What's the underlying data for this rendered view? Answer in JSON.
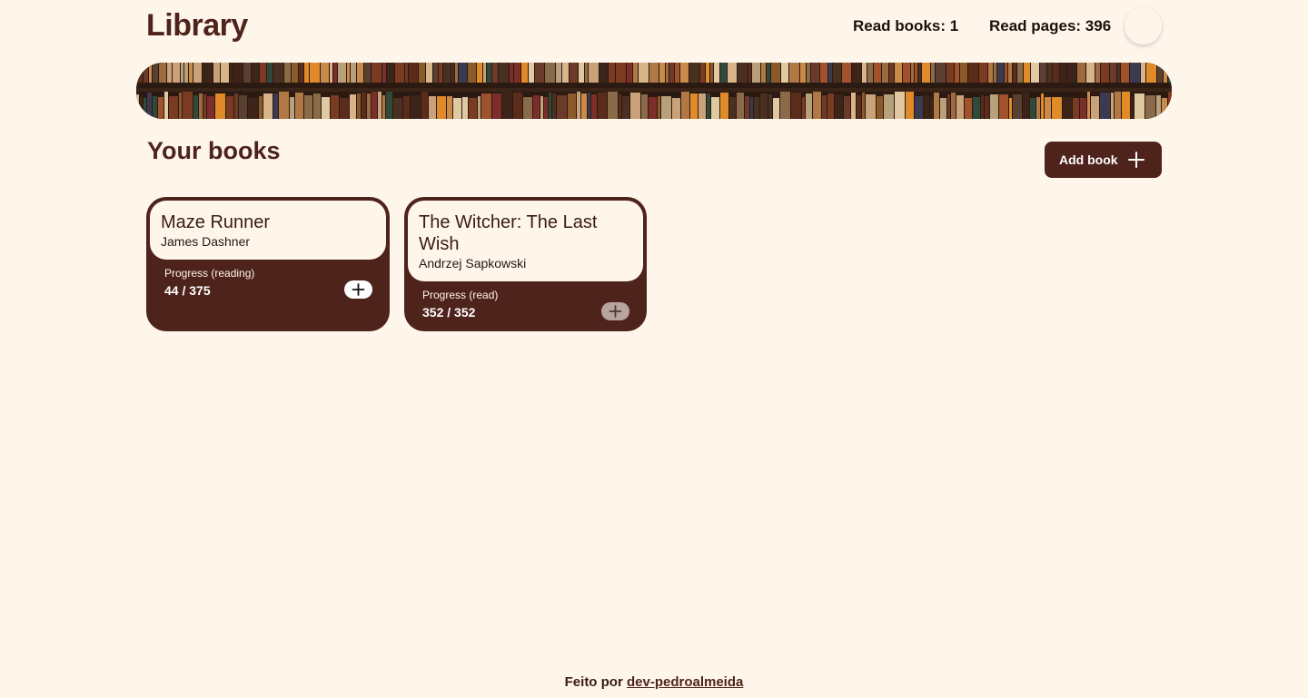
{
  "header": {
    "title": "Library",
    "read_books": "Read books: 1",
    "read_pages": "Read pages: 396"
  },
  "section": {
    "title": "Your books",
    "add_button_label": "Add book",
    "add_button_icon": "plus-icon"
  },
  "books": [
    {
      "title": "Maze Runner",
      "author": "James Dashner",
      "progress_label": "Progress (reading)",
      "progress_value": "44 / 375",
      "pages_read": 44,
      "pages_total": 375,
      "add_pages_enabled": true
    },
    {
      "title": "The Witcher: The Last Wish",
      "author": "Andrzej Sapkowski",
      "progress_label": "Progress (read)",
      "progress_value": "352 / 352",
      "pages_read": 352,
      "pages_total": 352,
      "add_pages_enabled": false
    }
  ],
  "footer": {
    "prefix": "Feito por",
    "link_text": "dev-pedroalmeida"
  },
  "colors": {
    "background": "#fff6eb",
    "primary": "#4e231b",
    "text_dark": "#1e110d",
    "disabled_button": "#b9a39d"
  }
}
